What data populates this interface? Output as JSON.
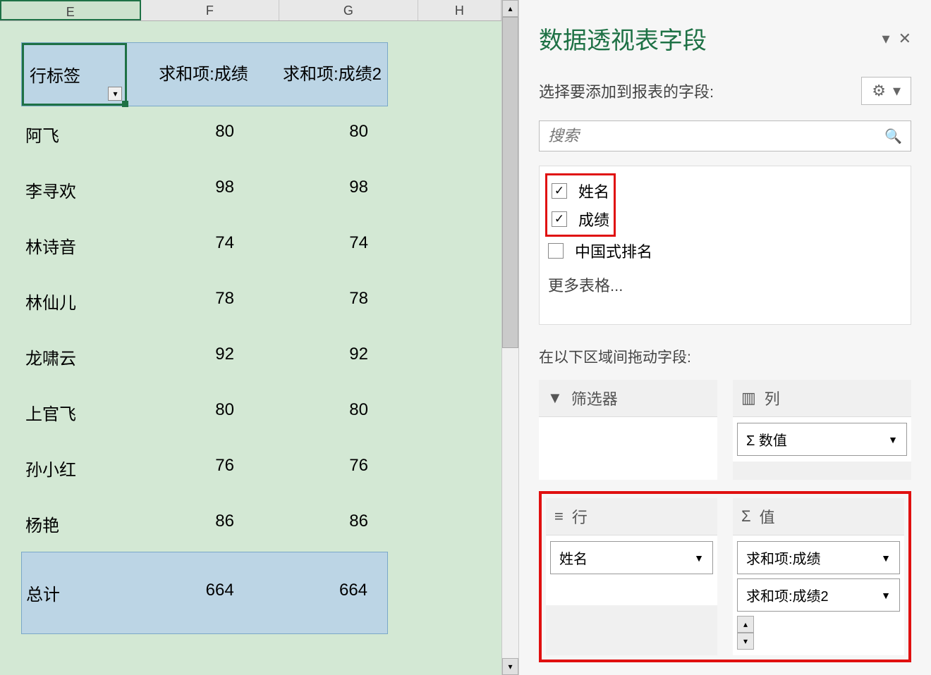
{
  "columns": [
    "E",
    "F",
    "G",
    "H"
  ],
  "pivot": {
    "row_label": "行标签",
    "col1": "求和项:成绩",
    "col2": "求和项:成绩2",
    "rows": [
      {
        "name": "阿飞",
        "v1": 80,
        "v2": 80
      },
      {
        "name": "李寻欢",
        "v1": 98,
        "v2": 98
      },
      {
        "name": "林诗音",
        "v1": 74,
        "v2": 74
      },
      {
        "name": "林仙儿",
        "v1": 78,
        "v2": 78
      },
      {
        "name": "龙啸云",
        "v1": 92,
        "v2": 92
      },
      {
        "name": "上官飞",
        "v1": 80,
        "v2": 80
      },
      {
        "name": "孙小红",
        "v1": 76,
        "v2": 76
      },
      {
        "name": "杨艳",
        "v1": 86,
        "v2": 86
      }
    ],
    "total_label": "总计",
    "total1": 664,
    "total2": 664
  },
  "pane": {
    "title": "数据透视表字段",
    "subtitle": "选择要添加到报表的字段:",
    "search_placeholder": "搜索",
    "fields": [
      {
        "label": "姓名",
        "checked": true
      },
      {
        "label": "成绩",
        "checked": true
      },
      {
        "label": "中国式排名",
        "checked": false
      }
    ],
    "more": "更多表格...",
    "areas_title": "在以下区域间拖动字段:",
    "filter_label": "筛选器",
    "col_label": "列",
    "row_area_label": "行",
    "val_area_label": "值",
    "col_chip": "Σ 数值",
    "row_chip": "姓名",
    "val_chips": [
      "求和项:成绩",
      "求和项:成绩2"
    ]
  }
}
